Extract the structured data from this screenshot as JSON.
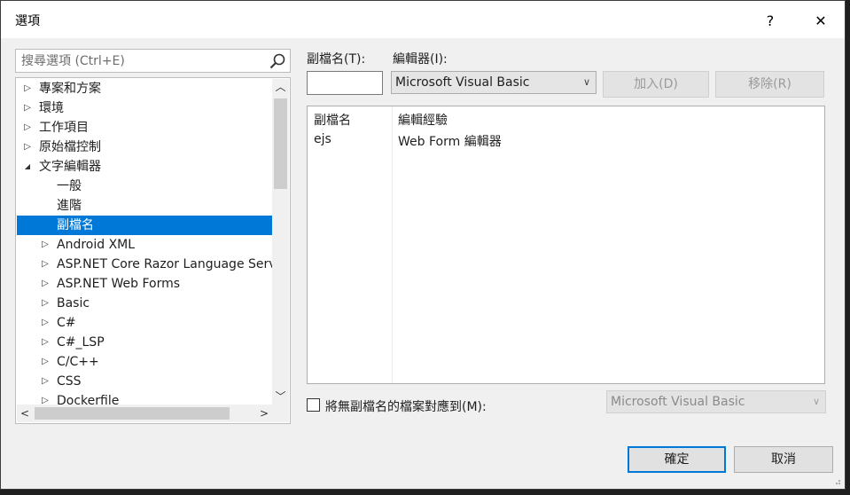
{
  "window": {
    "title": "選項",
    "help_glyph": "?",
    "close_glyph": "✕"
  },
  "search": {
    "placeholder": "搜尋選項 (Ctrl+E)"
  },
  "tree": {
    "items": [
      {
        "label": "專案和方案",
        "level": 0,
        "state": "collapsed"
      },
      {
        "label": "環境",
        "level": 0,
        "state": "collapsed"
      },
      {
        "label": "工作項目",
        "level": 0,
        "state": "collapsed"
      },
      {
        "label": "原始檔控制",
        "level": 0,
        "state": "collapsed"
      },
      {
        "label": "文字編輯器",
        "level": 0,
        "state": "expanded"
      },
      {
        "label": "一般",
        "level": 1,
        "state": "leaf"
      },
      {
        "label": "進階",
        "level": 1,
        "state": "leaf"
      },
      {
        "label": "副檔名",
        "level": 1,
        "state": "leaf",
        "selected": true
      },
      {
        "label": "Android XML",
        "level": 1,
        "state": "collapsed"
      },
      {
        "label": "ASP.NET Core Razor Language Server",
        "level": 1,
        "state": "collapsed"
      },
      {
        "label": "ASP.NET Web Forms",
        "level": 1,
        "state": "collapsed"
      },
      {
        "label": "Basic",
        "level": 1,
        "state": "collapsed"
      },
      {
        "label": "C#",
        "level": 1,
        "state": "collapsed"
      },
      {
        "label": "C#_LSP",
        "level": 1,
        "state": "collapsed"
      },
      {
        "label": "C/C++",
        "level": 1,
        "state": "collapsed"
      },
      {
        "label": "CSS",
        "level": 1,
        "state": "collapsed"
      },
      {
        "label": "Dockerfile",
        "level": 1,
        "state": "collapsed"
      }
    ]
  },
  "extension": {
    "label": "副檔名(T):",
    "value": ""
  },
  "editor": {
    "label": "編輯器(I):",
    "selected": "Microsoft Visual Basic"
  },
  "buttons": {
    "add": "加入(D)",
    "remove": "移除(R)",
    "ok": "確定",
    "cancel": "取消"
  },
  "mapping_table": {
    "headers": [
      "副檔名",
      "編輯經驗"
    ],
    "rows": [
      [
        "ejs",
        "Web Form 編輯器"
      ]
    ]
  },
  "map_no_ext": {
    "label": "將無副檔名的檔案對應到(M):",
    "checked": false,
    "selected": "Microsoft Visual Basic"
  },
  "colors": {
    "selection": "#0078d7",
    "dialog_bg": "#f0f0f0"
  }
}
